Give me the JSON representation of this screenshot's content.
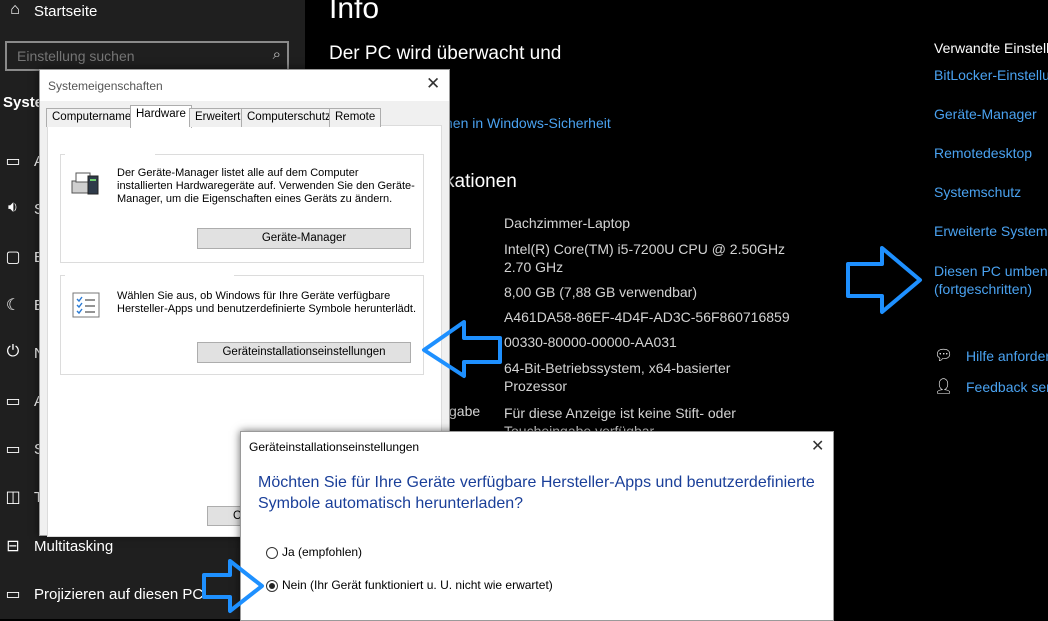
{
  "sidebar": {
    "home_label": "Startseite",
    "search_placeholder": "Einstellung suchen",
    "section_title": "System",
    "items": [
      {
        "icon": "display-icon",
        "label": "A"
      },
      {
        "icon": "sound-icon",
        "label": "S"
      },
      {
        "icon": "notification-icon",
        "label": "B"
      },
      {
        "icon": "focus-icon",
        "label": "B"
      },
      {
        "icon": "power-icon",
        "label": "N"
      },
      {
        "icon": "storage-icon",
        "label": "A"
      },
      {
        "icon": "tablet-icon",
        "label": "S"
      },
      {
        "icon": "tablet-mode-icon",
        "label": "T"
      },
      {
        "icon": "multitasking-icon",
        "label": "Multitasking"
      },
      {
        "icon": "project-icon",
        "label": "Projizieren auf diesen PC"
      }
    ]
  },
  "main": {
    "title": "Info",
    "subtitle": "Der PC wird überwacht und",
    "security_link": "hen in Windows-Sicherheit",
    "specs_heading": "kationen",
    "specs": [
      "Dachzimmer-Laptop",
      "Intel(R) Core(TM) i5-7200U CPU @ 2.50GHz",
      "2.70 GHz",
      "8,00 GB (7,88 GB verwendbar)",
      "A461DA58-86EF-4D4F-AD3C-56F860716859",
      "00330-80000-00000-AA031",
      "64-Bit-Betriebssystem, x64-basierter",
      "Prozessor",
      "Für diese Anzeige ist keine Stift- oder",
      "Toucheingabe verfügbar"
    ],
    "pen_label_fragment": "gabe"
  },
  "related": {
    "heading": "Verwandte Einstell",
    "links": [
      "BitLocker-Einstellu",
      "Geräte-Manager",
      "Remotedesktop",
      "Systemschutz",
      "Erweiterte Systeme",
      "Diesen PC umbene",
      "(fortgeschritten)"
    ],
    "help_label": "Hilfe anforder",
    "feedback_label": "Feedback sen"
  },
  "sysprops": {
    "title": "Systemeigenschaften",
    "tabs": [
      "Computername",
      "Hardware",
      "Erweitert",
      "Computerschutz",
      "Remote"
    ],
    "active_tab": "Hardware",
    "devmgr_group": "Geräte-Manager",
    "devmgr_text": "Der Geräte-Manager listet alle auf dem Computer installierten Hardwaregeräte auf. Verwenden Sie den Geräte-Manager, um die Eigenschaften eines Geräts zu ändern.",
    "devmgr_button": "Geräte-Manager",
    "install_group": "Geräteinstallationseinstellungen",
    "install_text": "Wählen Sie aus, ob Windows für Ihre Geräte verfügbare Hersteller-Apps und benutzerdefinierte Symbole herunterlädt.",
    "install_button": "Geräteinstallationseinstellungen",
    "ok_fragment": "O"
  },
  "install_dialog": {
    "title": "Geräteinstallationseinstellungen",
    "question": "Möchten Sie für Ihre Geräte verfügbare Hersteller-Apps und benutzerdefinierte Symbole automatisch herunterladen?",
    "options": [
      "Ja (empfohlen)",
      "Nein (Ihr Gerät funktioniert u. U. nicht wie erwartet)"
    ],
    "selected_option": "Nein (Ihr Gerät funktioniert u. U. nicht wie erwartet)"
  },
  "colors": {
    "link_blue": "#4aa2f0",
    "annotation_arrow": "#1e90ff",
    "dialog_heading_blue": "#003399"
  }
}
